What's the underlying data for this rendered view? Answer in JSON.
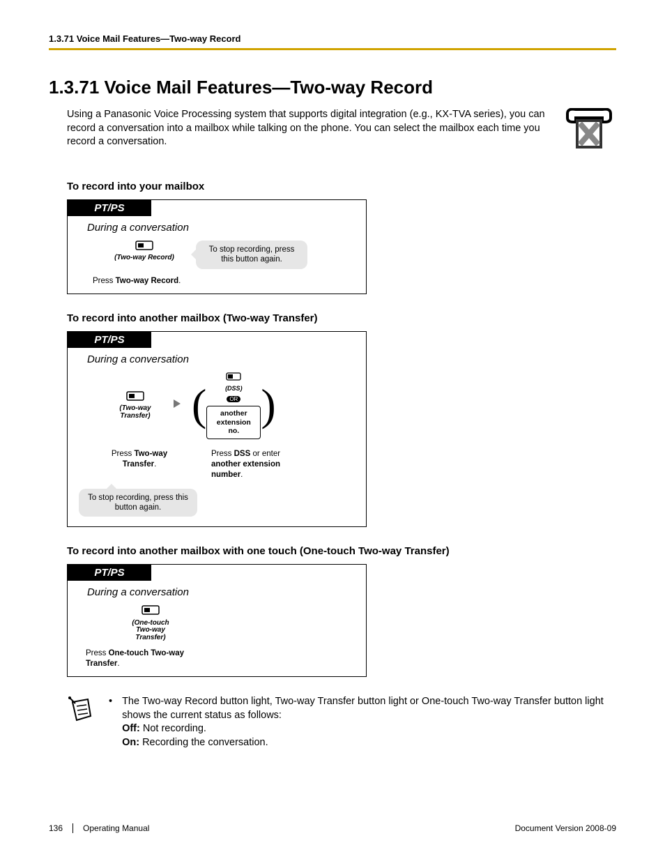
{
  "header": {
    "running": "1.3.71 Voice Mail Features—Two-way Record"
  },
  "title": "1.3.71  Voice Mail Features—Two-way Record",
  "intro": "Using a Panasonic Voice Processing system that supports digital integration (e.g., KX-TVA series), you can record a conversation into a mailbox while talking on the phone. You can select the mailbox each time you record a conversation.",
  "sec1": {
    "heading": "To record into your mailbox",
    "tab": "PT/PS",
    "during": "During a conversation",
    "btn_label": "(Two-way Record)",
    "callout": "To stop recording, press this button again.",
    "caption_pre": "Press ",
    "caption_bold": "Two-way Record",
    "caption_post": "."
  },
  "sec2": {
    "heading": "To record into another mailbox (Two-way Transfer)",
    "tab": "PT/PS",
    "during": "During a conversation",
    "btn_label": "(Two-way Transfer)",
    "opt_dss": "(DSS)",
    "or": "OR",
    "opt_ext1": "another",
    "opt_ext2": "extension no.",
    "cap1_pre": "Press ",
    "cap1_bold": "Two-way Transfer",
    "cap1_post": ".",
    "cap2_a": "Press ",
    "cap2_b": "DSS",
    "cap2_c": " or enter ",
    "cap2_d": "another extension number",
    "cap2_e": ".",
    "callout": "To stop recording, press this button again."
  },
  "sec3": {
    "heading": "To record into another mailbox with one touch (One-touch Two-way Transfer)",
    "tab": "PT/PS",
    "during": "During a conversation",
    "btn_label": "(One-touch Two-way Transfer)",
    "caption_pre": "Press ",
    "caption_bold": "One-touch Two-way Transfer",
    "caption_post": "."
  },
  "note": {
    "line1": "The Two-way Record button light, Two-way Transfer button light or One-touch Two-way Transfer button light shows the current status as follows:",
    "off_label": "Off:",
    "off_text": " Not recording.",
    "on_label": "On:",
    "on_text": " Recording the conversation."
  },
  "footer": {
    "page": "136",
    "manual": "Operating Manual",
    "docver": "Document Version  2008-09"
  }
}
